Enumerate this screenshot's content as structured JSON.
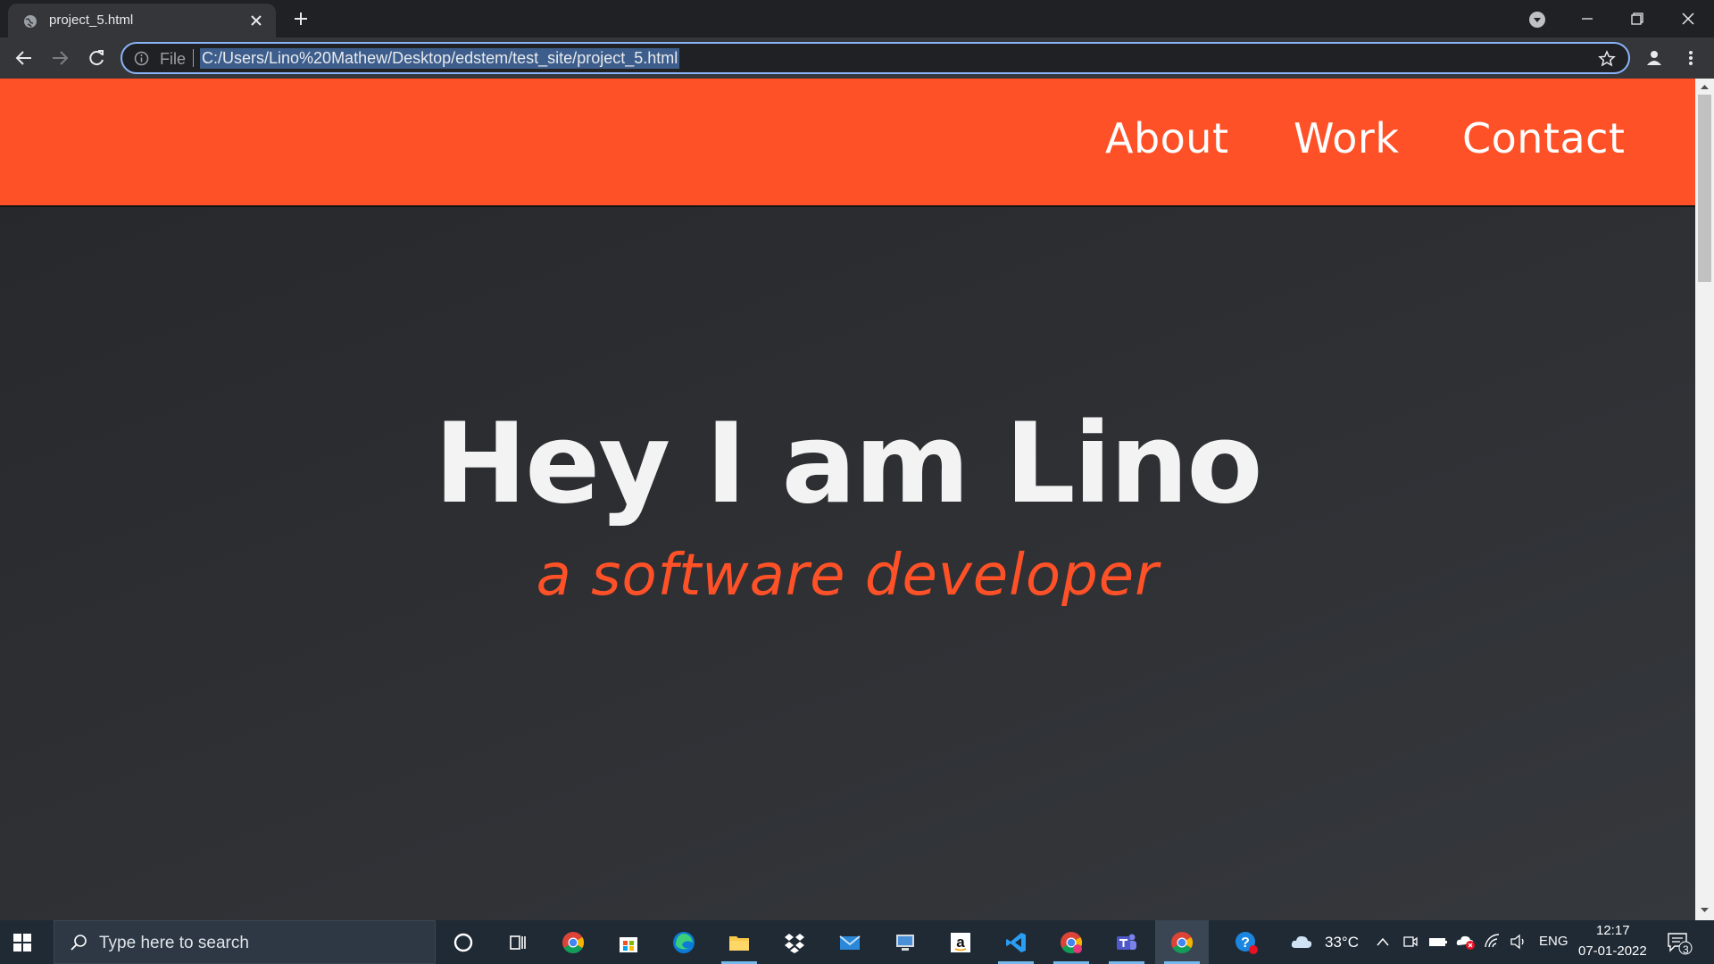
{
  "browser": {
    "tab_title": "project_5.html",
    "url_scheme_label": "File",
    "url": "C:/Users/Lino%20Mathew/Desktop/edstem/test_site/project_5.html",
    "icons": [
      "globe-icon",
      "close-icon",
      "plus-icon",
      "profile-dropdown-icon",
      "minimize-icon",
      "restore-icon",
      "window-close-icon",
      "back-icon",
      "forward-icon",
      "reload-icon",
      "info-icon",
      "star-icon",
      "account-icon",
      "kebab-menu-icon"
    ]
  },
  "site": {
    "nav": {
      "about": "About",
      "work": "Work",
      "contact": "Contact"
    },
    "hero": {
      "title": "Hey I am Lino",
      "subtitle": "a software developer"
    },
    "colors": {
      "accent": "#ff5127",
      "background": "#2b2c2f",
      "text": "#f3f3f3"
    }
  },
  "taskbar": {
    "search_placeholder": "Type here to search",
    "apps": [
      "cortana-icon",
      "task-view-icon",
      "chrome-icon",
      "store-icon",
      "edge-icon",
      "file-explorer-icon",
      "dropbox-icon",
      "mail-icon",
      "remote-desktop-icon",
      "amazon-icon",
      "vscode-icon",
      "chrome-profile-icon",
      "teams-icon",
      "chrome-active-icon",
      "help-icon"
    ],
    "weather": "33°C",
    "language": "ENG",
    "time": "12:17",
    "date": "07-01-2022",
    "notification_count": "3"
  }
}
